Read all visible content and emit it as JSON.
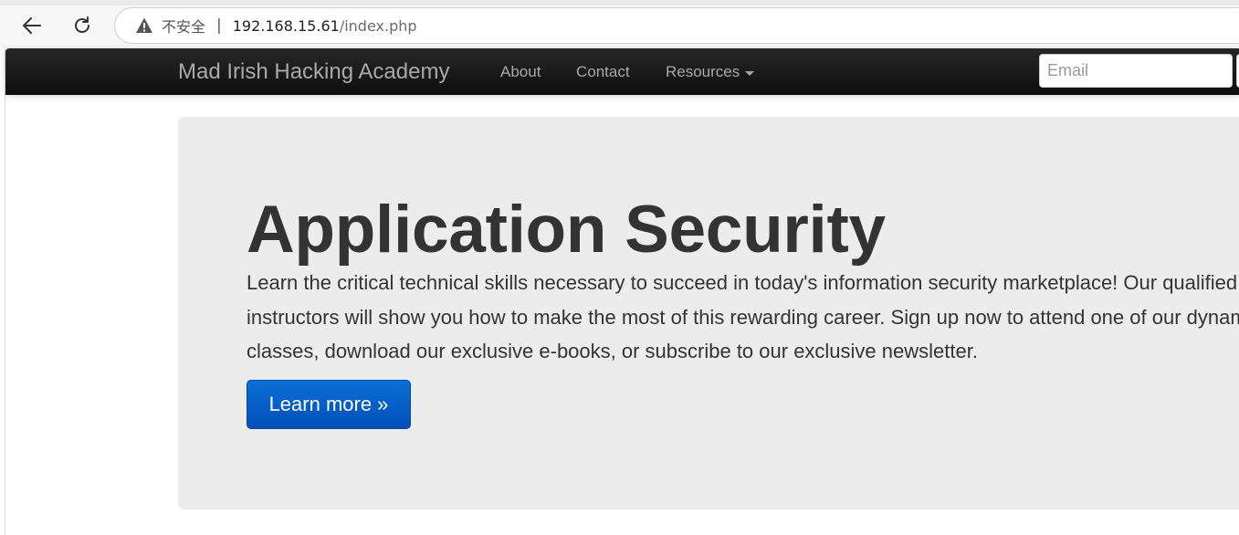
{
  "browser": {
    "security_label": "不安全",
    "url_host": "192.168.15.61",
    "url_path": "/index.php"
  },
  "navbar": {
    "brand": "Mad Irish Hacking Academy",
    "links": [
      "About",
      "Contact",
      "Resources"
    ],
    "email_placeholder": "Email"
  },
  "hero": {
    "title": "Application Security",
    "text": "Learn the critical technical skills necessary to succeed in today's information security marketplace! Our qualified instructors will show you how to make the most of this rewarding career. Sign up now to attend one of our dynamic classes, download our exclusive e-books, or subscribe to our exclusive newsletter.",
    "button_label": "Learn more »"
  },
  "colors": {
    "navbar": "#1a1a1a",
    "jumbotron": "#ececec",
    "button": "#0a62cc"
  }
}
